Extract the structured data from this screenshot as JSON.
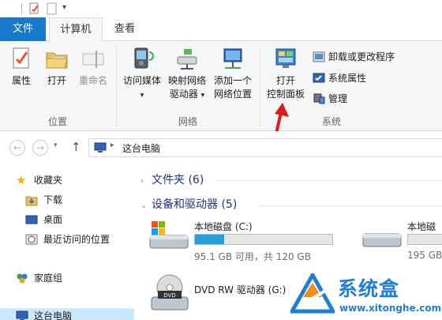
{
  "ribbon_tabs": {
    "file": "文件",
    "computer": "计算机",
    "view": "查看"
  },
  "location_group": {
    "label": "位置",
    "properties": "属性",
    "open": "打开",
    "rename": "重命名"
  },
  "network_group": {
    "label": "网络",
    "access_media": "访问媒体",
    "map_drive_line1": "映射网络",
    "map_drive_line2": "驱动器",
    "add_location_line1": "添加一个",
    "add_location_line2": "网络位置"
  },
  "system_group": {
    "label": "系统",
    "open_cp_line1": "打开",
    "open_cp_line2": "控制面板",
    "uninstall": "卸载或更改程序",
    "sys_props": "系统属性",
    "manage": "管理"
  },
  "address": {
    "path": "这台电脑"
  },
  "nav_pane": {
    "favorites": "收藏夹",
    "downloads": "下载",
    "desktop": "桌面",
    "recent": "最近访问的位置",
    "homegroup": "家庭组",
    "this_pc": "这台电脑"
  },
  "content": {
    "folders_header": "文件夹 (6)",
    "devices_header": "设备和驱动器 (5)",
    "drives": [
      {
        "name": "本地磁盘 (C:)",
        "size": "95.1 GB 可用，共 120 GB",
        "used_fraction": 0.21
      },
      {
        "name": "本地磁",
        "size": "195 GB",
        "used_fraction": 0.0
      },
      {
        "name": "DVD RW 驱动器 (G:)"
      }
    ]
  },
  "watermark": {
    "brand": "系统盒",
    "url": "www.xitonghe.com"
  },
  "colors": {
    "file_tab": "#1979ca",
    "accent_blue": "#1f7fd4",
    "drive_bar": "#26a0da",
    "arrow": "#e01b1b"
  }
}
